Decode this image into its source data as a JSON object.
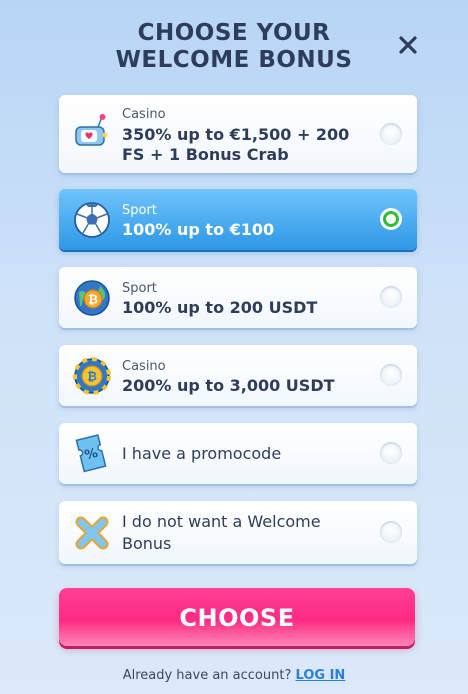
{
  "header": {
    "title_line1": "CHOOSE YOUR",
    "title_line2": "WELCOME BONUS",
    "close_icon": "close-icon"
  },
  "options": [
    {
      "category": "Casino",
      "title_line1": "350% up to €1,500 + 200",
      "title_line2": "FS + 1 Bonus Crab",
      "icon": "love-machine-icon",
      "selected": false
    },
    {
      "category": "Sport",
      "title": "100% up to €100",
      "icon": "soccer-ball-icon",
      "selected": true
    },
    {
      "category": "Sport",
      "title": "100% up to 200 USDT",
      "icon": "bitcoin-globe-icon",
      "selected": false
    },
    {
      "category": "Casino",
      "title": "200% up to 3,000 USDT",
      "icon": "bitcoin-chip-icon",
      "selected": false
    },
    {
      "title": "I have a promocode",
      "icon": "promo-ticket-icon",
      "selected": false
    },
    {
      "title_line1": "I do not want a Welcome",
      "title_line2": "Bonus",
      "icon": "cross-icon",
      "selected": false
    }
  ],
  "choose_button": {
    "label": "CHOOSE"
  },
  "footer": {
    "text": "Already have an account?",
    "link": "LOG IN"
  },
  "colors": {
    "accent_pink": "#ff2a83",
    "selected_blue": "#2e97e6",
    "radio_green": "#2fbd3a",
    "link_blue": "#2b7fd6"
  }
}
